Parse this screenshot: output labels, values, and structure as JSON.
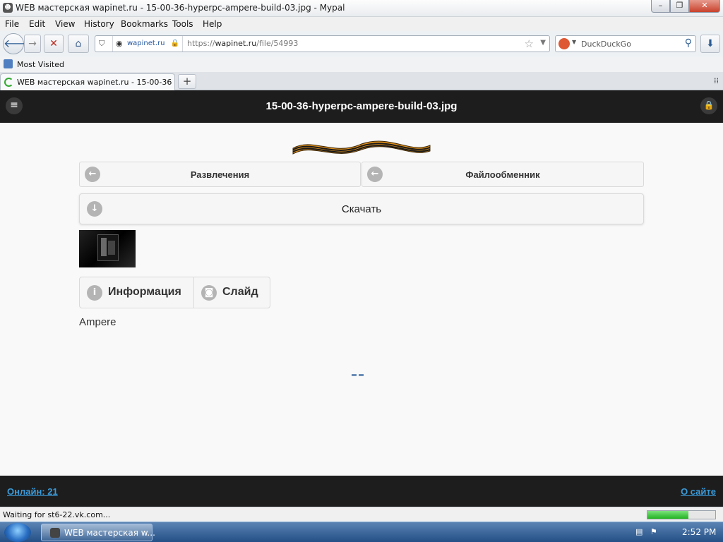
{
  "window": {
    "title": "WEB мастерская wapinet.ru - 15-00-36-hyperpc-ampere-build-03.jpg - Mypal"
  },
  "menu": [
    "File",
    "Edit",
    "View",
    "History",
    "Bookmarks",
    "Tools",
    "Help"
  ],
  "nav": {
    "site_identity": "wapinet.ru",
    "url_prefix": "https://",
    "url_host": "wapinet.ru",
    "url_path": "/file/54993",
    "search_placeholder": "DuckDuckGo"
  },
  "bookmarks": [
    "Most Visited"
  ],
  "tab": {
    "label": "WEB мастерская wapinet.ru - 15-00-36-h..."
  },
  "page": {
    "title": "15-00-36-hyperpc-ampere-build-03.jpg",
    "breadcrumbs": [
      "Развлечения",
      "Файлообменник"
    ],
    "download_label": "Скачать",
    "tabs": [
      "Информация",
      "Слайд"
    ],
    "description": "Ampere",
    "footer_left": "Онлайн: 21",
    "footer_right": "О сайте"
  },
  "status": {
    "text": "Waiting for st6-22.vk.com...",
    "progress_fraction": 0.6
  },
  "taskbar": {
    "task_label": "WEB мастерская w...",
    "clock": "2:52 PM"
  }
}
